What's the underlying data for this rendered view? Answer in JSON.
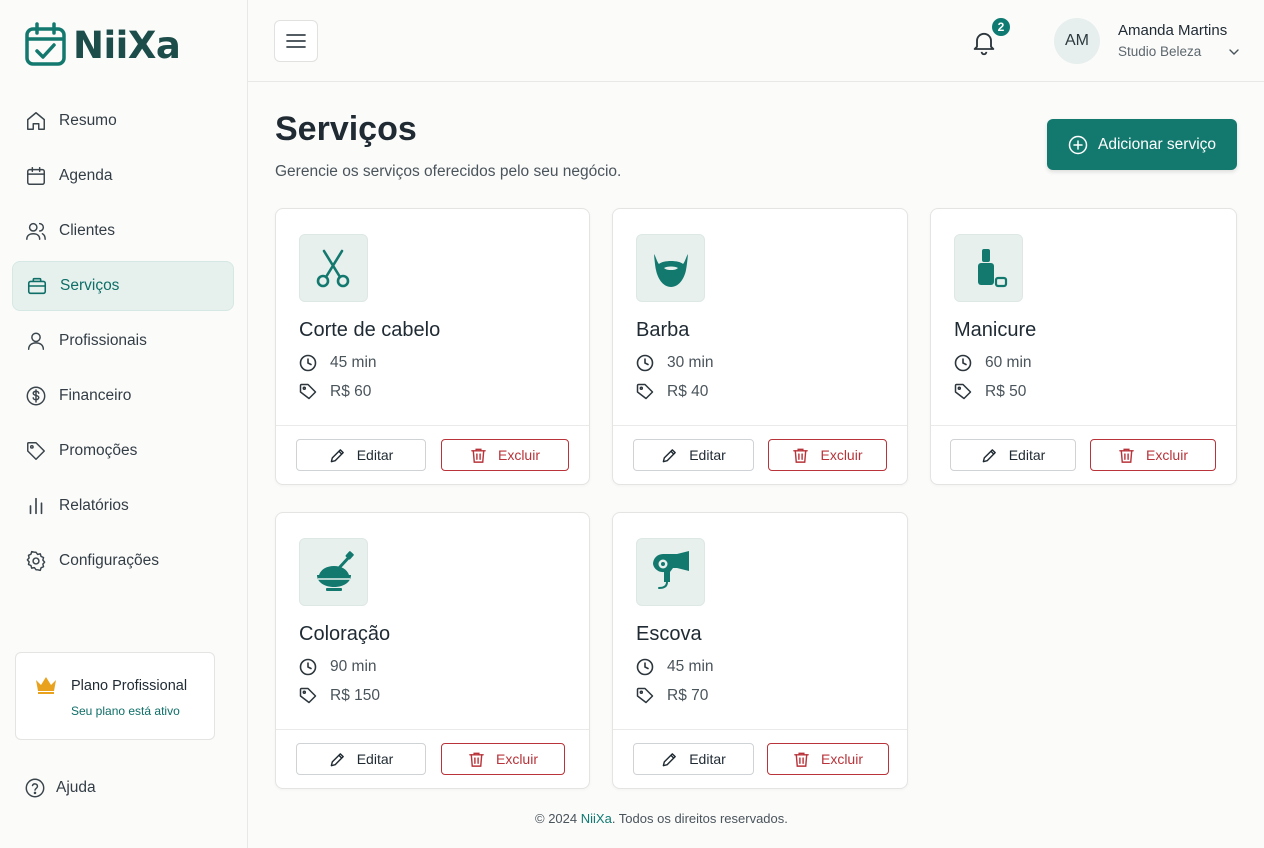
{
  "brand": {
    "name": "NiiXa",
    "accent": "#13796f"
  },
  "sidebar": {
    "items": [
      {
        "label": "Resumo",
        "icon": "home-icon"
      },
      {
        "label": "Agenda",
        "icon": "calendar-icon"
      },
      {
        "label": "Clientes",
        "icon": "users-icon"
      },
      {
        "label": "Serviços",
        "icon": "briefcase-icon",
        "active": true
      },
      {
        "label": "Profissionais",
        "icon": "user-icon"
      },
      {
        "label": "Financeiro",
        "icon": "dollar-icon"
      },
      {
        "label": "Promoções",
        "icon": "tag-icon"
      },
      {
        "label": "Relatórios",
        "icon": "bar-chart-icon"
      },
      {
        "label": "Configurações",
        "icon": "gear-icon"
      }
    ],
    "plan": {
      "title": "Plano Profissional",
      "status": "Seu plano está ativo"
    },
    "help_label": "Ajuda"
  },
  "topbar": {
    "notifications_count": "2",
    "user": {
      "initials": "AM",
      "name": "Amanda Martins",
      "business": "Studio Beleza"
    }
  },
  "page": {
    "title": "Serviços",
    "subtitle": "Gerencie os serviços oferecidos pelo seu negócio.",
    "add_button": "Adicionar serviço"
  },
  "services": [
    {
      "name": "Corte de cabelo",
      "duration": "45 min",
      "price": "R$ 60",
      "icon": "scissors-icon"
    },
    {
      "name": "Barba",
      "duration": "30 min",
      "price": "R$ 40",
      "icon": "beard-icon"
    },
    {
      "name": "Manicure",
      "duration": "60 min",
      "price": "R$ 50",
      "icon": "nail-polish-icon"
    },
    {
      "name": "Coloração",
      "duration": "90 min",
      "price": "R$ 150",
      "icon": "dye-bowl-icon"
    },
    {
      "name": "Escova",
      "duration": "45 min",
      "price": "R$ 70",
      "icon": "hair-dryer-icon"
    }
  ],
  "actions": {
    "edit": "Editar",
    "delete": "Excluir"
  },
  "footer": {
    "prefix": "© 2024 ",
    "brand": "NiiXa",
    "suffix": ". Todos os direitos reservados."
  }
}
